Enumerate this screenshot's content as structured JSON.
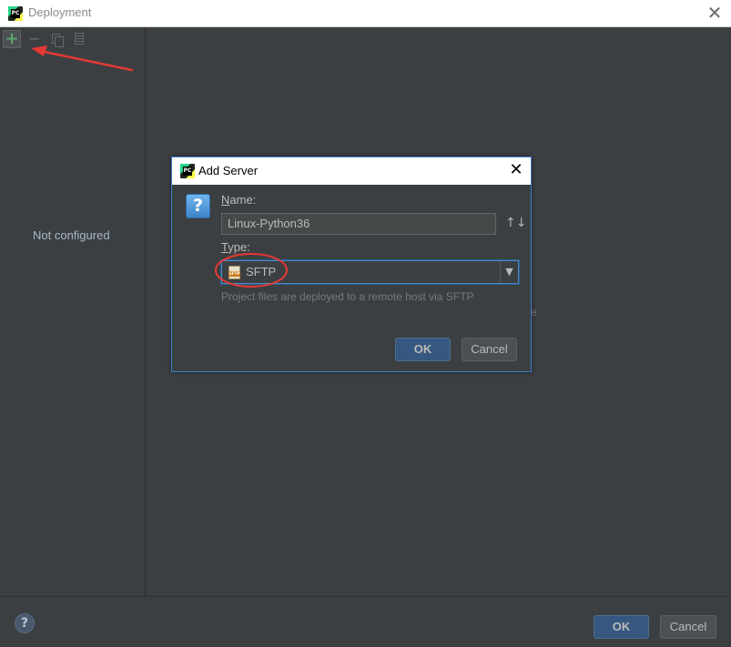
{
  "window": {
    "title": "Deployment"
  },
  "toolbar": {
    "add_icon": "plus-icon",
    "remove_icon": "minus-icon",
    "copy_icon": "copy-icon",
    "default_icon": "use-as-default-icon",
    "add_symbol": "+",
    "remove_symbol": "−"
  },
  "left_panel": {
    "empty_text": "Not configured"
  },
  "stray_text": "e",
  "dialog": {
    "title": "Add Server",
    "close_symbol": "✕",
    "help_symbol": "?",
    "name_label_first": "N",
    "name_label_rest": "ame:",
    "name_value": "Linux-Python36",
    "sort_symbol": "↑↓",
    "type_label_first": "T",
    "type_label_rest": "ype:",
    "type_value": "SFTP",
    "type_icon": "sftp-icon",
    "dropdown_symbol": "▼",
    "type_description": "Project files are deployed to a remote host via SFTP",
    "ok_label": "OK",
    "cancel_label": "Cancel"
  },
  "footer": {
    "help_symbol": "?",
    "ok_label": "OK",
    "cancel_label": "Cancel"
  },
  "colors": {
    "background": "#3c3f41",
    "accent_blue": "#365880",
    "focus_border": "#4a88c7",
    "annotation_red": "#e53935",
    "add_green": "#59a869"
  }
}
